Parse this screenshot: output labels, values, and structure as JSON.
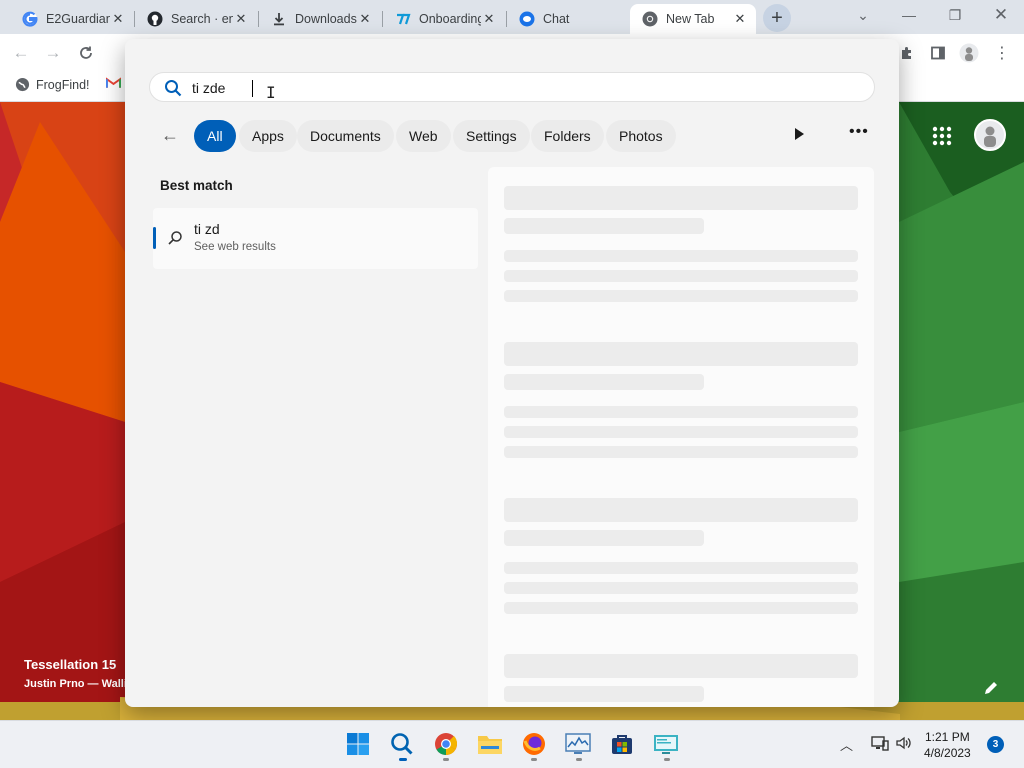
{
  "browser": {
    "tabs": [
      {
        "title": "E2Guardian",
        "icon": "google-icon"
      },
      {
        "title": "Search · en",
        "icon": "github-icon"
      },
      {
        "title": "Downloads",
        "icon": "download-icon"
      },
      {
        "title": "Onboarding",
        "icon": "onboarding-icon"
      },
      {
        "title": "Chat",
        "icon": "chat-icon"
      },
      {
        "title": "New Tab",
        "icon": "chrome-icon",
        "active": true
      }
    ],
    "new_tab_label": "+",
    "bookmarks": [
      {
        "label": "FrogFind!",
        "icon": "globe-icon"
      },
      {
        "label": "",
        "icon": "gmail-icon"
      }
    ]
  },
  "ntp": {
    "wallpaper_title": "Tessellation 15",
    "wallpaper_credit": "Justin Prno — Walli"
  },
  "search": {
    "query": "ti zde",
    "filters": [
      "All",
      "Apps",
      "Documents",
      "Web",
      "Settings",
      "Folders",
      "Photos"
    ],
    "active_filter": "All",
    "best_match_label": "Best match",
    "result": {
      "title": "ti zd",
      "subtitle": "See web results"
    }
  },
  "taskbar": {
    "apps": [
      "windows-start-icon",
      "search-icon",
      "chrome-icon",
      "file-explorer-icon",
      "firefox-icon",
      "task-manager-icon",
      "store-icon",
      "remote-desktop-icon"
    ],
    "time": "1:21 PM",
    "date": "4/8/2023",
    "notifications": "3"
  },
  "colors": {
    "accent": "#005fb8",
    "flyout_bg": "#f3f3f3",
    "tabbar_bg": "#dee3ea"
  }
}
